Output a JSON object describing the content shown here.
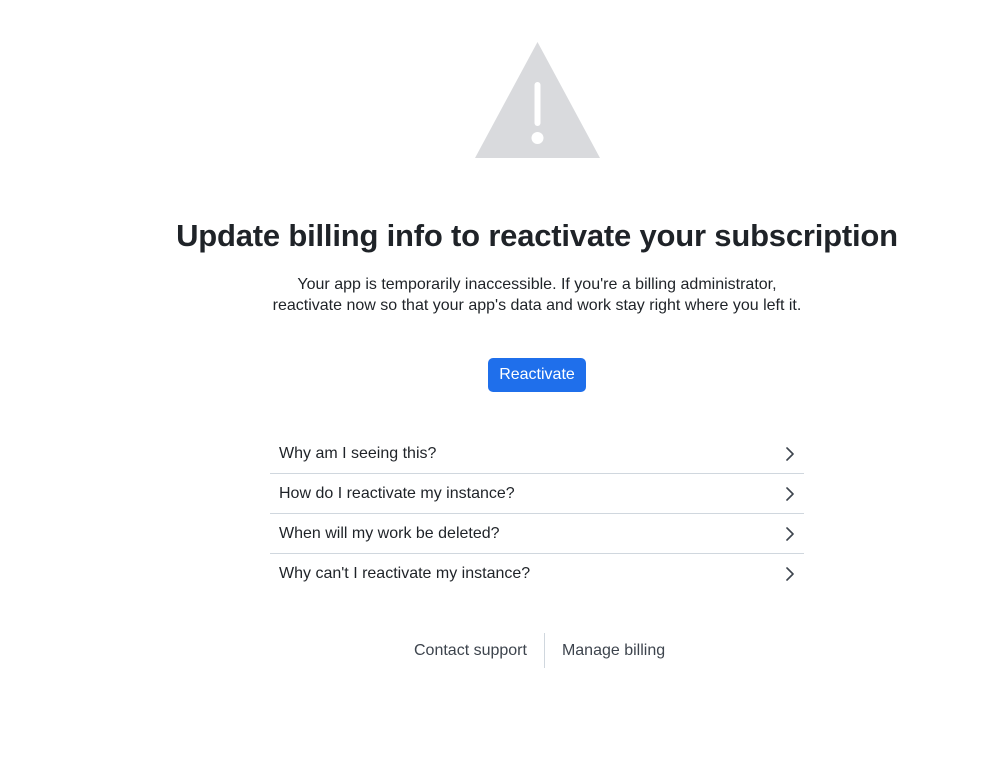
{
  "warning": {
    "icon": "warning-triangle-icon",
    "color": "#d9dadd"
  },
  "heading": {
    "title": "Update billing info to reactivate your subscription",
    "subtitle_line1": "Your app is temporarily inaccessible. If you're a billing administrator,",
    "subtitle_line2": "reactivate now so that your app's data and work stay right where you left it."
  },
  "actions": {
    "reactivate_label": "Reactivate",
    "accent_color": "#1f6feb"
  },
  "faq": {
    "items": [
      {
        "label": "Why am I seeing this?",
        "icon": "chevron-right-icon"
      },
      {
        "label": "How do I reactivate my instance?",
        "icon": "chevron-right-icon"
      },
      {
        "label": "When will my work be deleted?",
        "icon": "chevron-right-icon"
      },
      {
        "label": "Why can't I reactivate my instance?",
        "icon": "chevron-right-icon"
      }
    ]
  },
  "footer": {
    "contact_support": "Contact support",
    "manage_billing": "Manage billing"
  }
}
